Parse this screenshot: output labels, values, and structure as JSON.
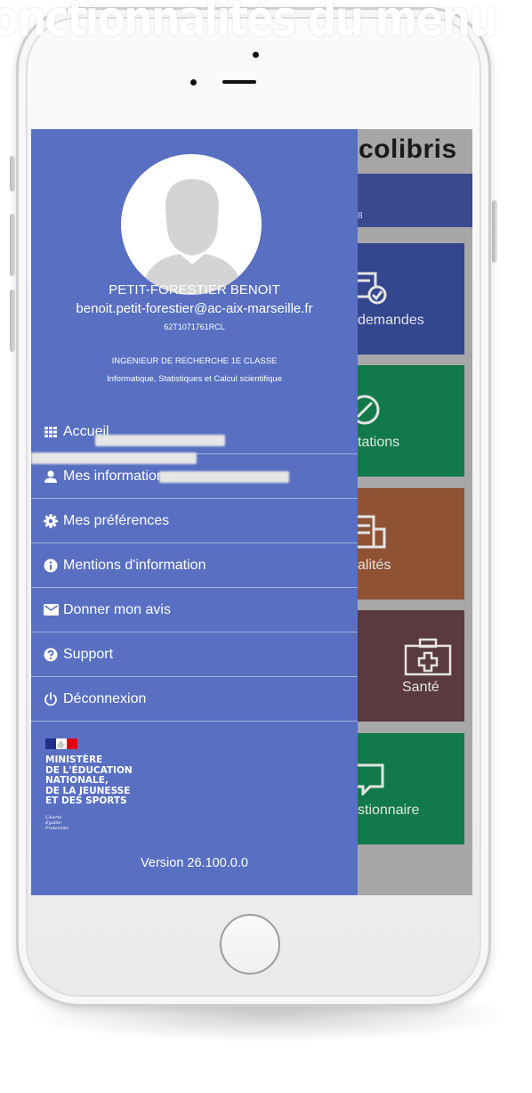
{
  "banner": {
    "text": "onctionnalités du menu"
  },
  "background_app": {
    "title": "colibris",
    "bar_text": "8",
    "tiles": [
      {
        "label": "demandes",
        "icon": "form-check-icon",
        "color": "#34468d"
      },
      {
        "label": "tations",
        "icon": "compass-icon",
        "color": "#127a4a"
      },
      {
        "label": "alités",
        "icon": "newspaper-icon",
        "color": "#8f5233"
      },
      {
        "label": "Santé",
        "icon": "medical-kit-icon",
        "color": "#5a3a3e"
      },
      {
        "label": "stionnaire",
        "icon": "chat-bubble-icon",
        "color": "#127a4a"
      }
    ]
  },
  "drawer": {
    "background_color": "#586fc2",
    "user": {
      "name": "PETIT-FORESTIER BENOIT",
      "email": "benoit.petit-forestier@ac-aix-marseille.fr",
      "id": "62T1071761RCL",
      "role": "INGENIEUR DE RECHERCHE 1E CLASSE",
      "department": "Informatique, Statistiques et Calcul scientifique"
    },
    "menu": [
      {
        "label": "Accueil",
        "icon": "grid-icon"
      },
      {
        "label": "Mes informations",
        "icon": "person-icon"
      },
      {
        "label": "Mes préférences",
        "icon": "gear-icon"
      },
      {
        "label": "Mentions d'information",
        "icon": "info-circle-icon"
      },
      {
        "label": "Donner mon avis",
        "icon": "envelope-icon"
      },
      {
        "label": "Support",
        "icon": "help-circle-icon"
      },
      {
        "label": "Déconnexion",
        "icon": "power-icon"
      }
    ],
    "ministry_logo": {
      "text": "MINISTÈRE\nDE L'ÉDUCATION\nNATIONALE,\nDE LA JEUNESSE\nET DES SPORTS",
      "motto": "Liberté\nÉgalité\nFraternité"
    },
    "version": "Version 26.100.0.0"
  }
}
